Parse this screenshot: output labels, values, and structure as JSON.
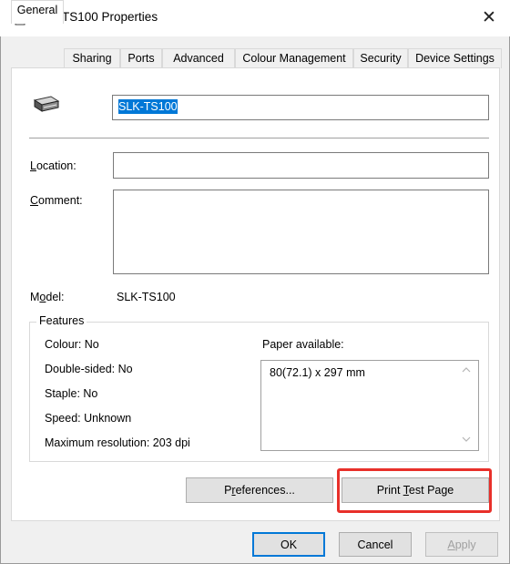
{
  "window": {
    "title": "SLK-TS100 Properties",
    "close_glyph": "✕"
  },
  "tabs": [
    {
      "label": "General",
      "active": true
    },
    {
      "label": "Sharing"
    },
    {
      "label": "Ports"
    },
    {
      "label": "Advanced"
    },
    {
      "label": "Colour Management"
    },
    {
      "label": "Security"
    },
    {
      "label": "Device Settings"
    }
  ],
  "general": {
    "printer_name": "SLK-TS100",
    "location": {
      "prefix": "",
      "accel": "L",
      "rest": "ocation:",
      "value": ""
    },
    "comment": {
      "accel": "C",
      "rest": "omment:",
      "value": ""
    },
    "model": {
      "pre": "M",
      "accel": "o",
      "rest": "del:",
      "value": "SLK-TS100"
    }
  },
  "features": {
    "title": "Features",
    "colour": "Colour: No",
    "double_sided": "Double-sided: No",
    "staple": "Staple: No",
    "speed": "Speed: Unknown",
    "max_resolution": "Maximum resolution: 203 dpi",
    "paper_label": "Paper available:",
    "paper_items": [
      "80(72.1) x 297 mm"
    ]
  },
  "buttons": {
    "preferences": {
      "pre": "P",
      "accel": "r",
      "rest": "eferences..."
    },
    "print_test": {
      "pre": "Print ",
      "accel": "T",
      "rest": "est Page"
    },
    "ok": "OK",
    "cancel": "Cancel",
    "apply": {
      "pre": "",
      "accel": "A",
      "rest": "pply"
    }
  },
  "colors": {
    "accent": "#0078d7",
    "highlight_box": "#e8302a"
  },
  "icons": [
    "printer-icon",
    "printer-3d-icon",
    "close-icon",
    "scroll-up-icon",
    "scroll-down-icon"
  ]
}
